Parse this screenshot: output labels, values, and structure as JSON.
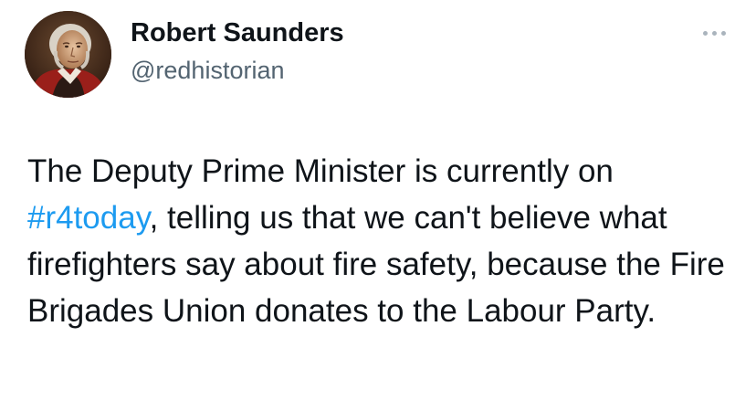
{
  "author": {
    "display_name": "Robert Saunders",
    "handle": "@redhistorian",
    "avatar_icon": "portrait-avatar"
  },
  "menu": {
    "more_icon": "more-options-icon"
  },
  "tweet": {
    "text_before": "The Deputy Prime Minister is currently on ",
    "hashtag": "#r4today",
    "text_after": ", telling us that we can't believe what firefighters say about fire safety, because the Fire Brigades Union donates to the Labour Party."
  },
  "colors": {
    "hashtag": "#1d9bf0",
    "handle": "#536471",
    "text": "#0f1419"
  }
}
